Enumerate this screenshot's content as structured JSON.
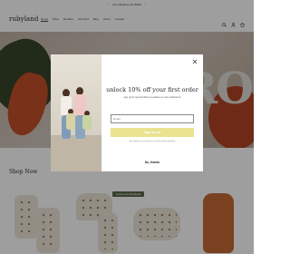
{
  "announcement": {
    "text": "free shipping over $150",
    "prev_icon": "chevron-left-icon",
    "next_icon": "chevron-right-icon"
  },
  "header": {
    "logo": "rubyland",
    "nav": [
      "Home",
      "Shop",
      "Bundles",
      "Gift Card",
      "Blog",
      "About",
      "Contact"
    ],
    "icons": [
      "search-icon",
      "account-icon",
      "cart-icon"
    ]
  },
  "hero": {
    "letters": "RO"
  },
  "section": {
    "title": "Shop Now",
    "badge": "Come see Rubyland"
  },
  "modal": {
    "title": "unlock 10% off your first order",
    "subtitle": "sign up for special offers & updates on new collections!",
    "email_placeholder": "Email",
    "signup_label": "Sign me up",
    "legal": "By signing up, you agree to receive email marketing",
    "no_thanks": "No, thanks",
    "close_icon": "close-icon"
  },
  "colors": {
    "signup": "#e9e28f",
    "overlay": "rgba(0,0,0,0.38)",
    "accent": "#5d6a4a"
  }
}
